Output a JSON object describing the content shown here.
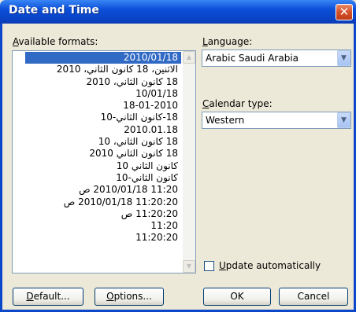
{
  "window": {
    "title": "Date and Time",
    "close_glyph": "✕"
  },
  "available_formats": {
    "label_accel": "A",
    "label_rest": "vailable formats:",
    "items": [
      "2010/01/18",
      "الاثنين، 18 كانون الثاني، 2010",
      "18 كانون الثاني، 2010",
      "10/01/18",
      "18-01-2010",
      "18-كانون الثاني-10",
      "2010.01.18",
      "18 كانون الثاني، 10",
      "18 كانون الثاني 2010",
      "كانون الثاني 10",
      "كانون الثاني-10",
      "11:20 2010/01/18 ص",
      "11:20:20 2010/01/18 ص",
      "11:20:20 ص",
      "11:20",
      "11:20:20"
    ],
    "selected_index": 0
  },
  "language": {
    "label_accel": "L",
    "label_rest": "anguage:",
    "value": "Arabic Saudi Arabia"
  },
  "calendar_type": {
    "label_accel": "C",
    "label_rest": "alendar type:",
    "value": "Western"
  },
  "update_automatically": {
    "label_accel": "U",
    "label_rest": "pdate automatically",
    "checked": false
  },
  "buttons": {
    "default_accel": "D",
    "default_rest": "efault...",
    "options_accel": "O",
    "options_rest": "ptions...",
    "ok": "OK",
    "cancel": "Cancel"
  },
  "icons": {
    "dropdown": "▼",
    "scroll_up": "▲",
    "scroll_down": "▼"
  }
}
